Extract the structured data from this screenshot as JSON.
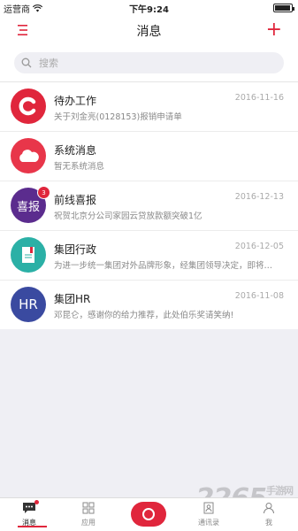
{
  "status_bar": {
    "carrier": "运营商",
    "time": "下午9:24"
  },
  "nav": {
    "title": "消息",
    "add_symbol": "+"
  },
  "search": {
    "placeholder": "搜索"
  },
  "messages": [
    {
      "title": "待办工作",
      "subtitle": "关于刘金亮(0128153)报销申请单",
      "date": "2016-11-16",
      "avatar_color": "#e0263c",
      "avatar_icon": "c-logo-icon"
    },
    {
      "title": "系统消息",
      "subtitle": "暂无系统消息",
      "date": "",
      "avatar_color": "#e8364a",
      "avatar_icon": "cloud-icon"
    },
    {
      "title": "前线喜报",
      "subtitle": "祝贺北京分公司家园云贷放款额突破1亿",
      "date": "2016-12-13",
      "avatar_color": "#5b2c8e",
      "avatar_text": "喜报",
      "badge": "3"
    },
    {
      "title": "集团行政",
      "subtitle": "为进一步统一集团对外品牌形象，经集团领导决定，即将…",
      "date": "2016-12-05",
      "avatar_color": "#2bb0a6",
      "avatar_icon": "document-icon"
    },
    {
      "title": "集团HR",
      "subtitle": "邓昆仑，感谢你的给力推荐，此处伯乐奖请笑纳!",
      "date": "2016-11-08",
      "avatar_color": "#3a4aa0",
      "avatar_text": "HR"
    }
  ],
  "tabs": [
    {
      "label": "消息",
      "icon": "chat-icon"
    },
    {
      "label": "应用",
      "icon": "grid-icon"
    },
    {
      "label": "通讯录",
      "icon": "contacts-icon"
    },
    {
      "label": "我",
      "icon": "person-icon"
    }
  ],
  "watermark": {
    "text": "2265",
    "suffix": "手游网"
  }
}
